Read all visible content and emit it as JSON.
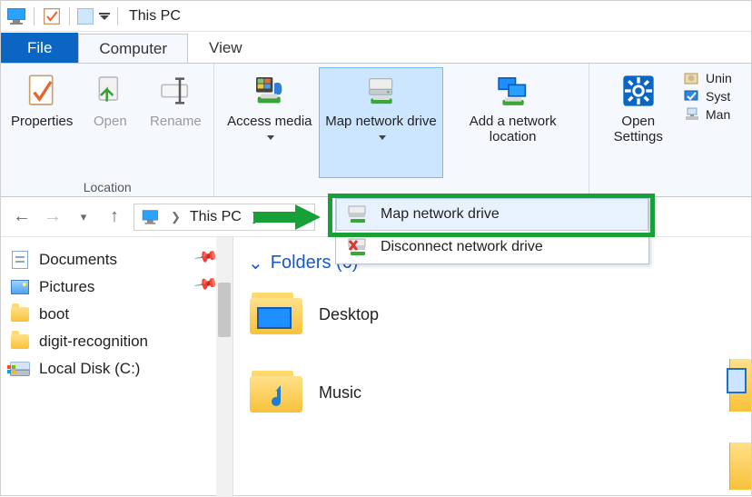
{
  "window": {
    "title": "This PC"
  },
  "tabs": {
    "file": "File",
    "computer": "Computer",
    "view": "View"
  },
  "ribbon": {
    "location": {
      "label": "Location",
      "properties": "Properties",
      "open": "Open",
      "rename": "Rename"
    },
    "network": {
      "access_media": "Access media",
      "map_network_drive": "Map network drive",
      "add_network_location": "Add a network location"
    },
    "system": {
      "open_settings": "Open Settings",
      "uninstall": "Unin",
      "system_props": "Syst",
      "manage": "Man"
    }
  },
  "dropdown": {
    "map": "Map network drive",
    "disconnect": "Disconnect network drive"
  },
  "breadcrumb": {
    "root": "This PC"
  },
  "sidebar": {
    "items": [
      {
        "label": "Documents",
        "pinned": true
      },
      {
        "label": "Pictures",
        "pinned": true
      },
      {
        "label": "boot",
        "pinned": false
      },
      {
        "label": "digit-recognition",
        "pinned": false
      },
      {
        "label": "Local Disk (C:)",
        "pinned": false
      }
    ]
  },
  "content": {
    "section_title": "Folders (6)",
    "folders": [
      {
        "label": "Desktop"
      },
      {
        "label": "Music"
      }
    ]
  }
}
